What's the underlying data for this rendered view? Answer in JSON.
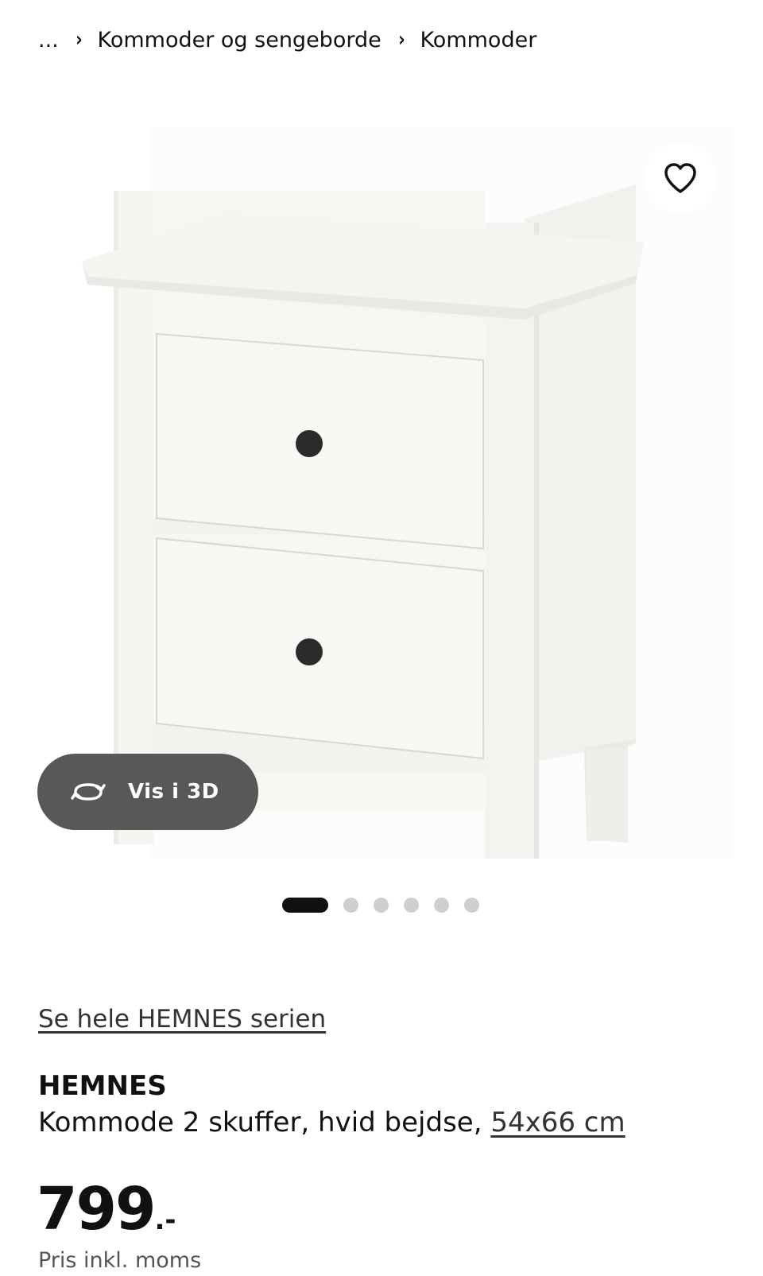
{
  "breadcrumb": {
    "ellipsis": "...",
    "items": [
      "Kommoder og sengeborde",
      "Kommoder"
    ]
  },
  "gallery": {
    "image_alt": "HEMNES Kommode 2 skuffer, hvid bejdse",
    "favorite_icon": "heart-outline-icon",
    "view_3d": {
      "icon": "rotate-3d-icon",
      "label": "Vis i 3D"
    },
    "image_count": 6,
    "active_index": 0
  },
  "product": {
    "series_link": "Se hele HEMNES serien",
    "name": "HEMNES",
    "description": "Kommode 2 skuffer, hvid bejdse, ",
    "dimensions": "54x66 cm",
    "price": "799",
    "price_suffix": ".-",
    "price_note": "Pris inkl. moms"
  },
  "colors": {
    "text": "#111111",
    "button_3d_bg": "#585858",
    "dot_inactive": "#cfcfcf",
    "dot_active": "#111111"
  }
}
